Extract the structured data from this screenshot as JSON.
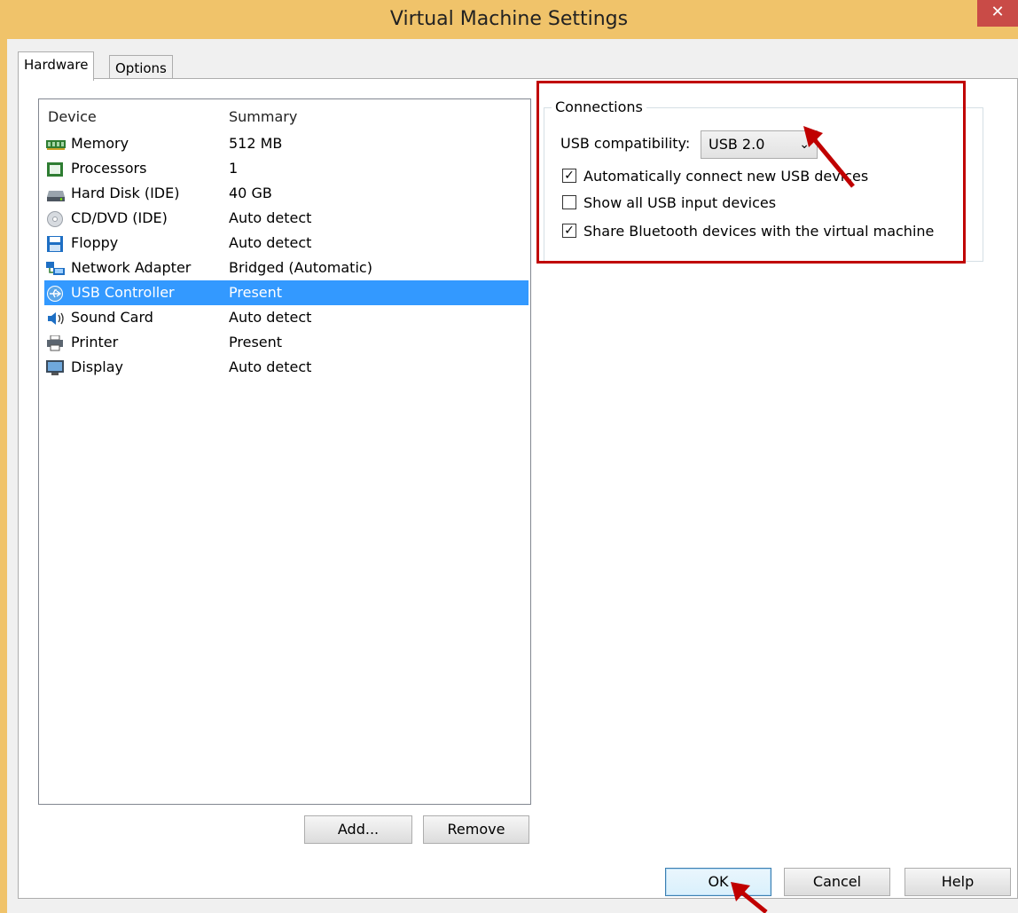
{
  "window": {
    "title": "Virtual Machine Settings",
    "close_glyph": "✕"
  },
  "tabs": [
    {
      "label": "Hardware",
      "active": true
    },
    {
      "label": "Options",
      "active": false
    }
  ],
  "device_list": {
    "headers": {
      "device": "Device",
      "summary": "Summary"
    },
    "rows": [
      {
        "device": "Memory",
        "summary": "512 MB",
        "icon": "memory-icon"
      },
      {
        "device": "Processors",
        "summary": "1",
        "icon": "processor-icon"
      },
      {
        "device": "Hard Disk (IDE)",
        "summary": "40 GB",
        "icon": "hard-disk-icon"
      },
      {
        "device": "CD/DVD (IDE)",
        "summary": "Auto detect",
        "icon": "cd-dvd-icon"
      },
      {
        "device": "Floppy",
        "summary": "Auto detect",
        "icon": "floppy-icon"
      },
      {
        "device": "Network Adapter",
        "summary": "Bridged (Automatic)",
        "icon": "network-adapter-icon"
      },
      {
        "device": "USB Controller",
        "summary": "Present",
        "icon": "usb-icon",
        "selected": true
      },
      {
        "device": "Sound Card",
        "summary": "Auto detect",
        "icon": "sound-card-icon"
      },
      {
        "device": "Printer",
        "summary": "Present",
        "icon": "printer-icon"
      },
      {
        "device": "Display",
        "summary": "Auto detect",
        "icon": "display-icon"
      }
    ]
  },
  "list_buttons": {
    "add": "Add...",
    "remove": "Remove"
  },
  "connections": {
    "title": "Connections",
    "usb_compat_label": "USB compatibility:",
    "usb_compat_value": "USB 2.0",
    "checkboxes": [
      {
        "label": "Automatically connect new USB devices",
        "checked": true
      },
      {
        "label": "Show all USB input devices",
        "checked": false
      },
      {
        "label": "Share Bluetooth devices with the virtual machine",
        "checked": true
      }
    ]
  },
  "footer_buttons": {
    "ok": "OK",
    "cancel": "Cancel",
    "help": "Help"
  },
  "colors": {
    "titlebar": "#f0c36a",
    "selection": "#3399ff",
    "annotation": "#c00000"
  }
}
